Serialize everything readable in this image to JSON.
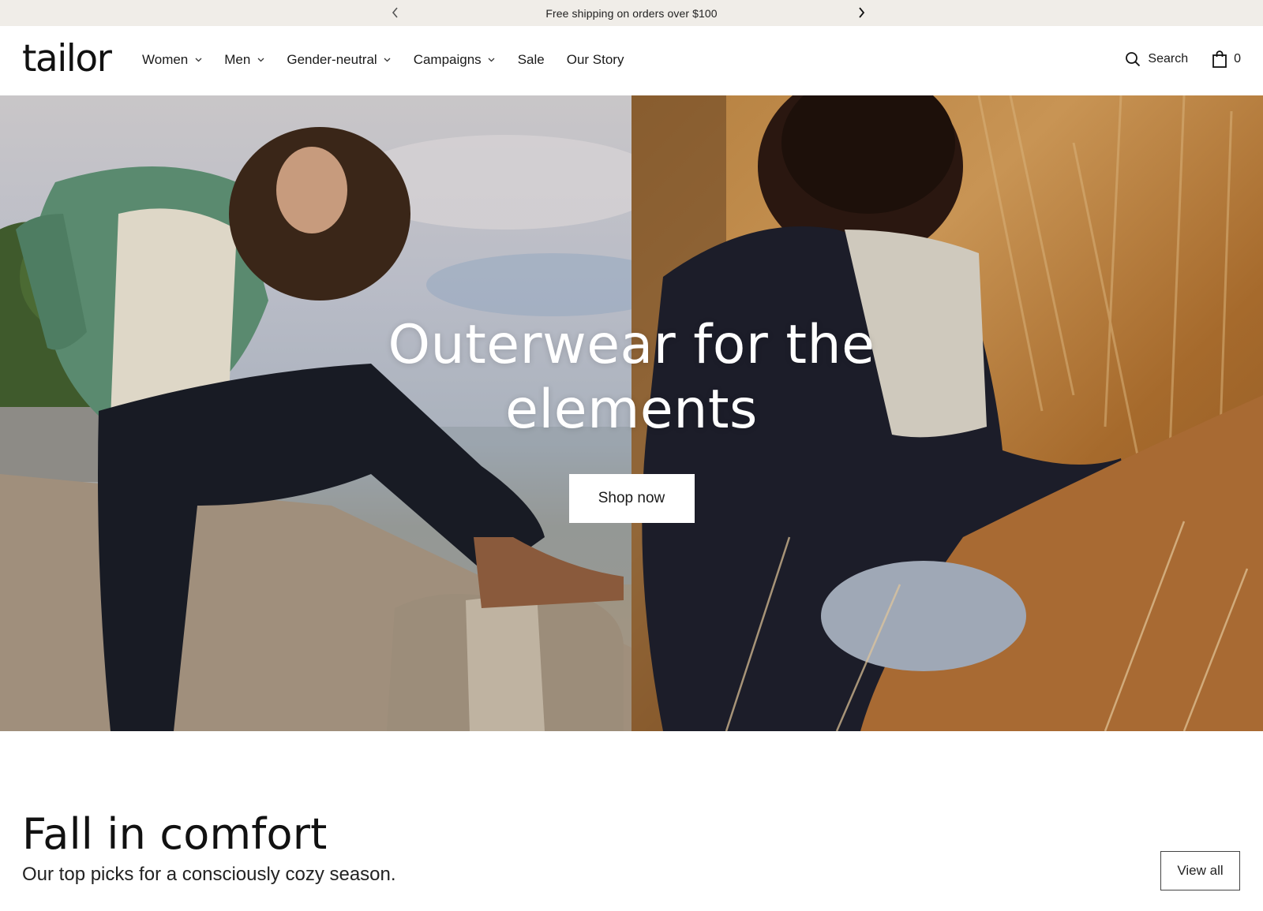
{
  "announcement": {
    "message": "Free shipping on orders over $100",
    "prev_icon": "chevron-left-icon",
    "next_icon": "chevron-right-icon"
  },
  "header": {
    "logo": "tailor",
    "nav": [
      {
        "label": "Women",
        "has_dropdown": true
      },
      {
        "label": "Men",
        "has_dropdown": true
      },
      {
        "label": "Gender-neutral",
        "has_dropdown": true
      },
      {
        "label": "Campaigns",
        "has_dropdown": true
      },
      {
        "label": "Sale",
        "has_dropdown": false
      },
      {
        "label": "Our Story",
        "has_dropdown": false
      }
    ],
    "search_label": "Search",
    "cart_count": "0"
  },
  "hero": {
    "title": "Outerwear for the elements",
    "button_label": "Shop now"
  },
  "section": {
    "title": "Fall in comfort",
    "subtitle": "Our top picks for a consciously cozy season.",
    "view_all_label": "View all"
  },
  "colors": {
    "announcement_bg": "#f0ede8",
    "text": "#1a1a1a",
    "hero_text": "#ffffff"
  }
}
